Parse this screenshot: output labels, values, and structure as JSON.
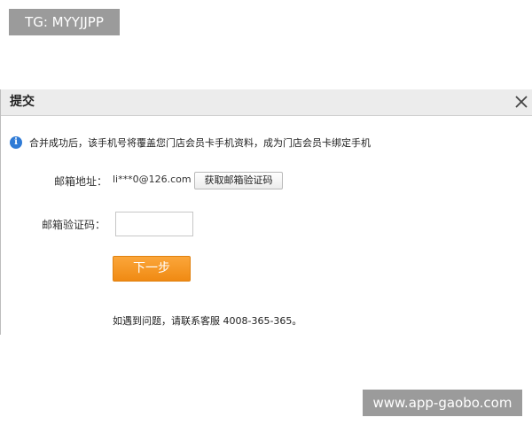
{
  "overlay": {
    "tg_label": "TG: MYYJJPP",
    "watermark": "www.app-gaobo.com"
  },
  "dialog": {
    "title": "提交",
    "notice": "合并成功后，该手机号将覆盖您门店会员卡手机资料，成为门店会员卡绑定手机",
    "email_label": "邮箱地址：",
    "email_value": "li***0@126.com",
    "get_code_button": "获取邮箱验证码",
    "code_label": "邮箱验证码：",
    "code_value": "",
    "next_button": "下一步",
    "help_text": "如遇到问题，请联系客服 4008-365-365。"
  },
  "colors": {
    "accent_button": "#f39419",
    "info_icon": "#2f7bd6",
    "header_bg": "#ececec"
  },
  "icons": {
    "info": "info-icon",
    "close": "close-icon"
  }
}
